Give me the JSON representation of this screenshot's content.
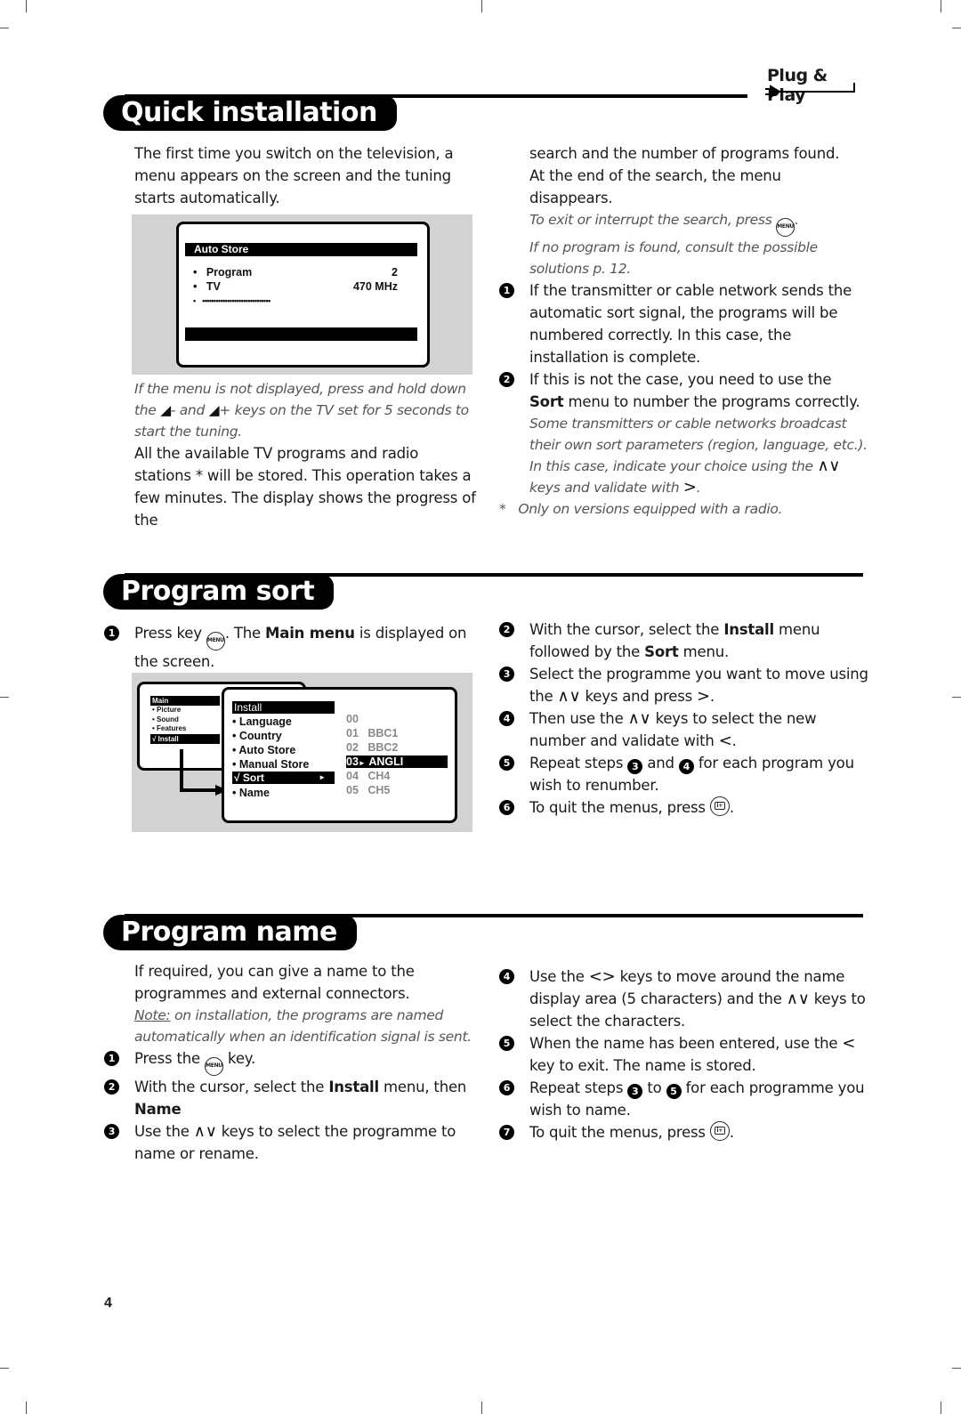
{
  "badge": {
    "label": "Plug & Play",
    "icon": "plug-icon"
  },
  "page_number": "4",
  "quick_installation": {
    "title": "Quick installation",
    "intro": "The first time you switch on the television, a menu appears on the screen and the tuning starts automatically.",
    "osd": {
      "title": "Auto Store",
      "rows": [
        {
          "label": "Program",
          "value": "2"
        },
        {
          "label": "TV",
          "value": "470 MHz"
        },
        {
          "label": "••••••••••••••••••••••••••••••",
          "value": ""
        }
      ],
      "bullet": "•"
    },
    "note_italic_1": "If the menu is not displayed, press and hold down the",
    "note_italic_2": "- and",
    "note_italic_3": "+ keys on the TV set for 5 seconds to start the tuning.",
    "para_stored": "All the available TV programs and radio stations * will be stored. This operation takes a few minutes. The display shows the progress of the",
    "para_cont": "search and the number of programs found.",
    "para_end": "At the end of the search, the menu disappears.",
    "exit_note": "To exit or interrupt the search, press",
    "noprog_note": "If no program is found, consult the possible solutions p. 12.",
    "steps": [
      {
        "num": "1",
        "text": "If the transmitter or cable network sends the automatic sort signal, the programs will be numbered correctly. In this case, the installation is complete."
      },
      {
        "num": "2",
        "text_pre": "If this is not the case, you need to use the",
        "bold": "Sort",
        "text_post": "menu to number the programs correctly."
      }
    ],
    "sort_note_1": "Some transmitters or cable networks broadcast their own sort parameters (region, language, etc.). In this case, indicate your choice using the",
    "sort_note_2": "keys and validate with",
    "footnote_mark": "*",
    "footnote": "Only on versions equipped with a radio."
  },
  "program_sort": {
    "title": "Program sort",
    "steps": [
      {
        "num": "1",
        "pre": "Press key",
        "mid": ". The",
        "bold": "Main menu",
        "post": "is displayed on the screen."
      },
      {
        "num": "2",
        "pre": "With the cursor, select the",
        "bold1": "Install",
        "mid": "menu followed by the",
        "bold2": "Sort",
        "post": "menu."
      },
      {
        "num": "3",
        "pre": "Select the programme you want to move using the",
        "mid": "keys and press",
        "post": "."
      },
      {
        "num": "4",
        "pre": "Then use the",
        "mid": "keys to select the new number and validate with",
        "post": "."
      },
      {
        "num": "5",
        "pre": "Repeat steps",
        "ref1": "3",
        "mid": "and",
        "ref2": "4",
        "post": "for each program you wish to renumber."
      },
      {
        "num": "6",
        "pre": "To quit the menus, press",
        "post": "."
      }
    ],
    "osd": {
      "main_title": "Main",
      "main_items": [
        "• Picture",
        "• Sound",
        "• Features"
      ],
      "main_selected": "√ Install",
      "install_title": "Install",
      "install_items": [
        "• Language",
        "• Country",
        "• Auto Store",
        "• Manual Store"
      ],
      "install_selected": "√ Sort",
      "install_selected_arrow": "►",
      "install_last": "• Name",
      "programs": [
        {
          "num": "00",
          "name": ""
        },
        {
          "num": "01",
          "name": "BBC1"
        },
        {
          "num": "02",
          "name": "BBC2"
        },
        {
          "num": "03",
          "name": "ANGLI",
          "selected": true,
          "marker": "►"
        },
        {
          "num": "04",
          "name": "CH4"
        },
        {
          "num": "05",
          "name": "CH5"
        }
      ]
    }
  },
  "program_name": {
    "title": "Program name",
    "intro": "If required, you can give a name to the programmes and external connectors.",
    "note_label": "Note:",
    "note_text": "on installation, the programs are named automatically when an identification signal is sent.",
    "steps": [
      {
        "num": "1",
        "pre": "Press the",
        "post": "key."
      },
      {
        "num": "2",
        "pre": "With the cursor, select the",
        "bold1": "Install",
        "mid": "menu, then",
        "bold2": "Name"
      },
      {
        "num": "3",
        "pre": "Use the",
        "post": "keys to select the programme to name or rename."
      },
      {
        "num": "4",
        "pre": "Use the",
        "mid": "keys to move around the name display area (5 characters) and the",
        "post": "keys to select the characters."
      },
      {
        "num": "5",
        "pre": "When the name has been entered, use the",
        "post": "key to exit. The name is stored."
      },
      {
        "num": "6",
        "pre": "Repeat steps",
        "ref1": "3",
        "mid": "to",
        "ref2": "5",
        "post": "for each programme you wish to name."
      },
      {
        "num": "7",
        "pre": "To quit the menus, press",
        "post": "."
      }
    ]
  },
  "keys": {
    "menu": "MENU",
    "info": "i+",
    "up_down": "∧∨",
    "right": ">",
    "left": "<",
    "left_right": "<>",
    "vol_glyph": "◢"
  }
}
